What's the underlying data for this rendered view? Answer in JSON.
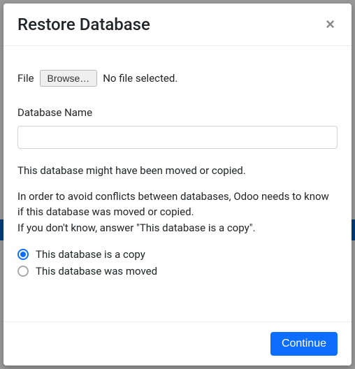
{
  "modal": {
    "title": "Restore Database",
    "close_symbol": "×"
  },
  "file": {
    "label": "File",
    "browse_label": "Browse…",
    "status": "No file selected."
  },
  "dbname": {
    "label": "Database Name",
    "value": ""
  },
  "info": {
    "line1": "This database might have been moved or copied.",
    "line2": "In order to avoid conflicts between databases, Odoo needs to know if this database was moved or copied.",
    "line3": "If you don't know, answer \"This database is a copy\"."
  },
  "options": {
    "copy_label": "This database is a copy",
    "move_label": "This database was moved",
    "selected": "copy"
  },
  "footer": {
    "continue_label": "Continue"
  }
}
